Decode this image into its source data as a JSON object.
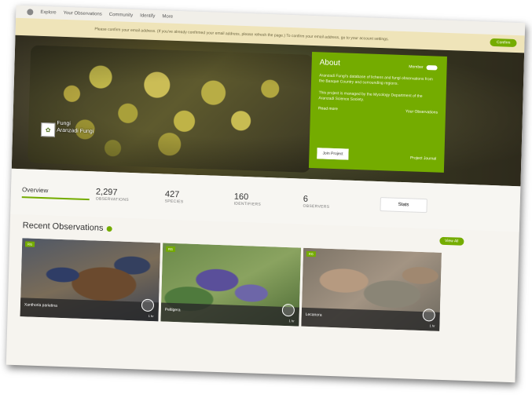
{
  "nav": {
    "items": [
      "Explore",
      "Your Observations",
      "Community",
      "Identify",
      "More"
    ]
  },
  "banner": {
    "text": "Please confirm your email address. (If you've already confirmed your email address, please refresh the page.) To confirm your email address, go to your account settings.",
    "button_label": "Confirm"
  },
  "hero": {
    "project_name_line1": "Fungi",
    "project_name_line2": "Aranzadi Fungi"
  },
  "about": {
    "title": "About",
    "member_label": "Member",
    "description_1": "Aranzadi Fungi's database of lichens and fungi observations from the Basque Country and surrounding regions.",
    "description_2": "This project is managed by the Mycology Department of the Aranzadi Science Society.",
    "read_more": "Read more",
    "your_observations": "Your Observations",
    "join_button": "Join Project",
    "join2": "Project Journal"
  },
  "stats": {
    "overview": "Overview",
    "observations_count": "2,297",
    "observations_label": "OBSERVATIONS",
    "species_count": "427",
    "species_label": "SPECIES",
    "identifiers_count": "160",
    "identifiers_label": "IDENTIFIERS",
    "observers_count": "6",
    "observers_label": "OBSERVERS",
    "stats_button": "Stats"
  },
  "recent": {
    "title": "Recent Observations",
    "view_all": "View All",
    "cards": [
      {
        "badge": "RG",
        "name": "Xanthoria parietina",
        "meta": "1 hr"
      },
      {
        "badge": "RG",
        "name": "Peltigera",
        "meta": "1 hr"
      },
      {
        "badge": "RG",
        "name": "Lecanora",
        "meta": "1 hr"
      }
    ]
  },
  "colors": {
    "accent": "#74ac00",
    "banner": "#efe4b9"
  }
}
